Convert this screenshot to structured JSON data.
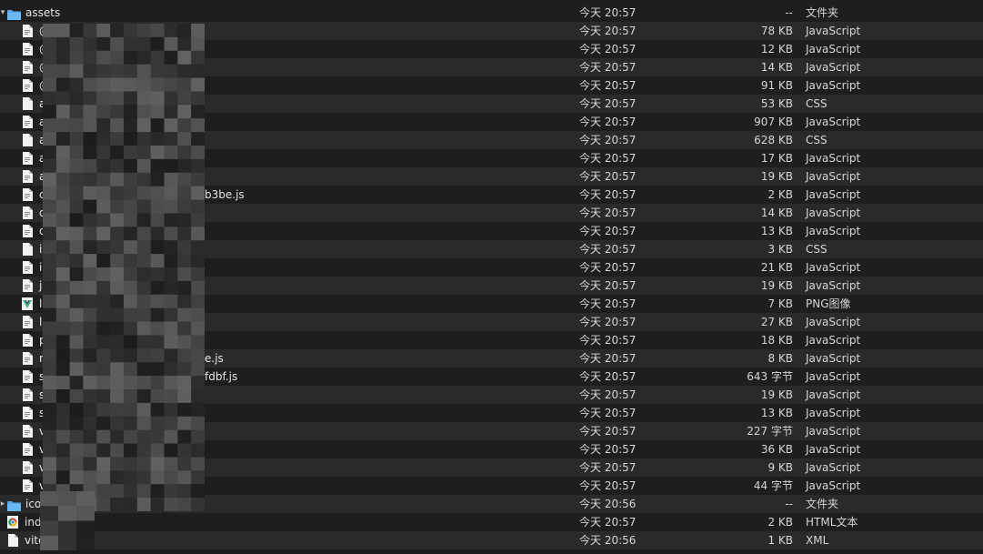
{
  "window": {
    "title": "assets"
  },
  "rows": [
    {
      "name": "assets",
      "date": "今天 20:57",
      "size": "--",
      "kind": "文件夹",
      "icon": "folder-icon",
      "indent": 0,
      "expanded": true
    },
    {
      "name": "@",
      "date": "今天 20:57",
      "size": "78 KB",
      "kind": "JavaScript",
      "icon": "document-icon",
      "indent": 1
    },
    {
      "name": "@",
      "date": "今天 20:57",
      "size": "12 KB",
      "kind": "JavaScript",
      "icon": "document-icon",
      "indent": 1
    },
    {
      "name": "@",
      "date": "今天 20:57",
      "size": "14 KB",
      "kind": "JavaScript",
      "icon": "document-icon",
      "indent": 1
    },
    {
      "name": "@",
      "date": "今天 20:57",
      "size": "91 KB",
      "kind": "JavaScript",
      "icon": "document-icon",
      "indent": 1
    },
    {
      "name": "a",
      "date": "今天 20:57",
      "size": "53 KB",
      "kind": "CSS",
      "icon": "blank-document-icon",
      "indent": 1
    },
    {
      "name": "a",
      "date": "今天 20:57",
      "size": "907 KB",
      "kind": "JavaScript",
      "icon": "document-icon",
      "indent": 1
    },
    {
      "name": "a",
      "date": "今天 20:57",
      "size": "628 KB",
      "kind": "CSS",
      "icon": "blank-document-icon",
      "indent": 1
    },
    {
      "name": "a",
      "date": "今天 20:57",
      "size": "17 KB",
      "kind": "JavaScript",
      "icon": "document-icon",
      "indent": 1
    },
    {
      "name": "a",
      "date": "今天 20:57",
      "size": "19 KB",
      "kind": "JavaScript",
      "icon": "document-icon",
      "indent": 1
    },
    {
      "name": "c",
      "tail": "b3be.js",
      "date": "今天 20:57",
      "size": "2 KB",
      "kind": "JavaScript",
      "icon": "document-icon",
      "indent": 1
    },
    {
      "name": "d",
      "date": "今天 20:57",
      "size": "14 KB",
      "kind": "JavaScript",
      "icon": "document-icon",
      "indent": 1
    },
    {
      "name": "d",
      "date": "今天 20:57",
      "size": "13 KB",
      "kind": "JavaScript",
      "icon": "document-icon",
      "indent": 1
    },
    {
      "name": "i",
      "date": "今天 20:57",
      "size": "3 KB",
      "kind": "CSS",
      "icon": "blank-document-icon",
      "indent": 1
    },
    {
      "name": "i",
      "date": "今天 20:57",
      "size": "21 KB",
      "kind": "JavaScript",
      "icon": "document-icon",
      "indent": 1
    },
    {
      "name": "js",
      "date": "今天 20:57",
      "size": "19 KB",
      "kind": "JavaScript",
      "icon": "document-icon",
      "indent": 1
    },
    {
      "name": "l",
      "date": "今天 20:57",
      "size": "7 KB",
      "kind": "PNG图像",
      "icon": "vue-logo-icon",
      "indent": 1
    },
    {
      "name": "l",
      "date": "今天 20:57",
      "size": "27 KB",
      "kind": "JavaScript",
      "icon": "document-icon",
      "indent": 1
    },
    {
      "name": "p",
      "date": "今天 20:57",
      "size": "18 KB",
      "kind": "JavaScript",
      "icon": "document-icon",
      "indent": 1
    },
    {
      "name": "r",
      "tail": "e.js",
      "date": "今天 20:57",
      "size": "8 KB",
      "kind": "JavaScript",
      "icon": "document-icon",
      "indent": 1
    },
    {
      "name": "s",
      "tail": "fdbf.js",
      "date": "今天 20:57",
      "size": "643 字节",
      "kind": "JavaScript",
      "icon": "document-icon",
      "indent": 1
    },
    {
      "name": "s",
      "date": "今天 20:57",
      "size": "19 KB",
      "kind": "JavaScript",
      "icon": "document-icon",
      "indent": 1
    },
    {
      "name": "s",
      "date": "今天 20:57",
      "size": "13 KB",
      "kind": "JavaScript",
      "icon": "document-icon",
      "indent": 1
    },
    {
      "name": "v",
      "date": "今天 20:57",
      "size": "227 字节",
      "kind": "JavaScript",
      "icon": "document-icon",
      "indent": 1
    },
    {
      "name": "v",
      "date": "今天 20:57",
      "size": "36 KB",
      "kind": "JavaScript",
      "icon": "document-icon",
      "indent": 1
    },
    {
      "name": "v",
      "date": "今天 20:57",
      "size": "9 KB",
      "kind": "JavaScript",
      "icon": "document-icon",
      "indent": 1
    },
    {
      "name": "v",
      "date": "今天 20:57",
      "size": "44 字节",
      "kind": "JavaScript",
      "icon": "document-icon",
      "indent": 1
    },
    {
      "name": "icon",
      "date": "今天 20:56",
      "size": "--",
      "kind": "文件夹",
      "icon": "folder-icon",
      "indent": 0,
      "expanded": false
    },
    {
      "name": "inde",
      "date": "今天 20:57",
      "size": "2 KB",
      "kind": "HTML文本",
      "icon": "chrome-html-icon",
      "indent": 0
    },
    {
      "name": "vite",
      "date": "今天 20:56",
      "size": "1 KB",
      "kind": "XML",
      "icon": "blank-document-icon",
      "indent": 0
    }
  ],
  "colors": {
    "background": "#1e1e1e",
    "alternate_row": "#2a2a2a",
    "folder_blue": "#5aa9ea",
    "text": "#dcdcdc"
  }
}
